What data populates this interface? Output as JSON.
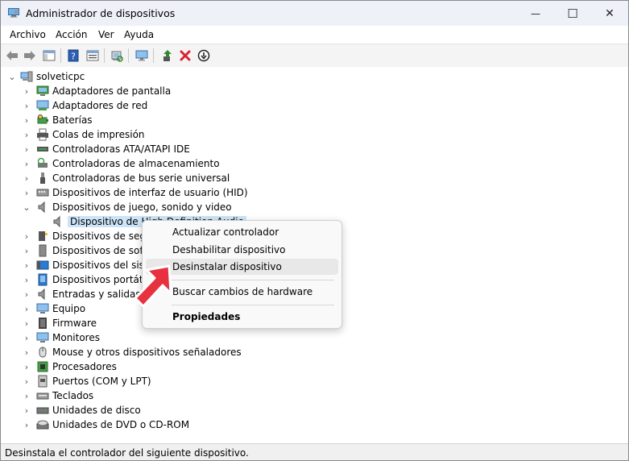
{
  "window": {
    "title": "Administrador de dispositivos",
    "minimize_glyph": "—",
    "maximize_glyph": "☐",
    "close_glyph": "✕"
  },
  "menu": [
    "Archivo",
    "Acción",
    "Ver",
    "Ayuda"
  ],
  "toolbar": {
    "icons": [
      "back-arrow-icon",
      "forward-arrow-icon",
      "show-hide-console-tree-icon",
      "help-icon",
      "properties-icon",
      "scan-hardware-icon",
      "monitor-icon",
      "update-driver-icon",
      "uninstall-x-icon",
      "disable-device-icon"
    ]
  },
  "tree": {
    "root": "solveticpc",
    "expanded_category": "Dispositivos de juego, sonido y video",
    "selected_child": "Dispositivo de High Definition Audio",
    "categories": [
      "Adaptadores de pantalla",
      "Adaptadores de red",
      "Baterías",
      "Colas de impresión",
      "Controladoras ATA/ATAPI IDE",
      "Controladoras de almacenamiento",
      "Controladoras de bus serie universal",
      "Dispositivos de interfaz de usuario (HID)",
      "Dispositivos de juego, sonido y video",
      "Dispositivos de seguridad",
      "Dispositivos de software",
      "Dispositivos del sistema",
      "Dispositivos portátiles",
      "Entradas y salidas de audio",
      "Equipo",
      "Firmware",
      "Monitores",
      "Mouse y otros dispositivos señaladores",
      "Procesadores",
      "Puertos (COM y LPT)",
      "Teclados",
      "Unidades de disco",
      "Unidades de DVD o CD-ROM"
    ]
  },
  "context_menu": {
    "items": [
      "Actualizar controlador",
      "Deshabilitar dispositivo",
      "Desinstalar dispositivo",
      "Buscar cambios de hardware",
      "Propiedades"
    ],
    "highlighted": "Desinstalar dispositivo"
  },
  "status_bar": {
    "text": "Desinstala el controlador del siguiente dispositivo."
  },
  "colors": {
    "titlebar": "#eef1f8",
    "selection": "#cce4f7",
    "pointer_arrow": "#e8313f",
    "uninstall_x": "#d9232f",
    "update_green": "#2e8b2e"
  }
}
